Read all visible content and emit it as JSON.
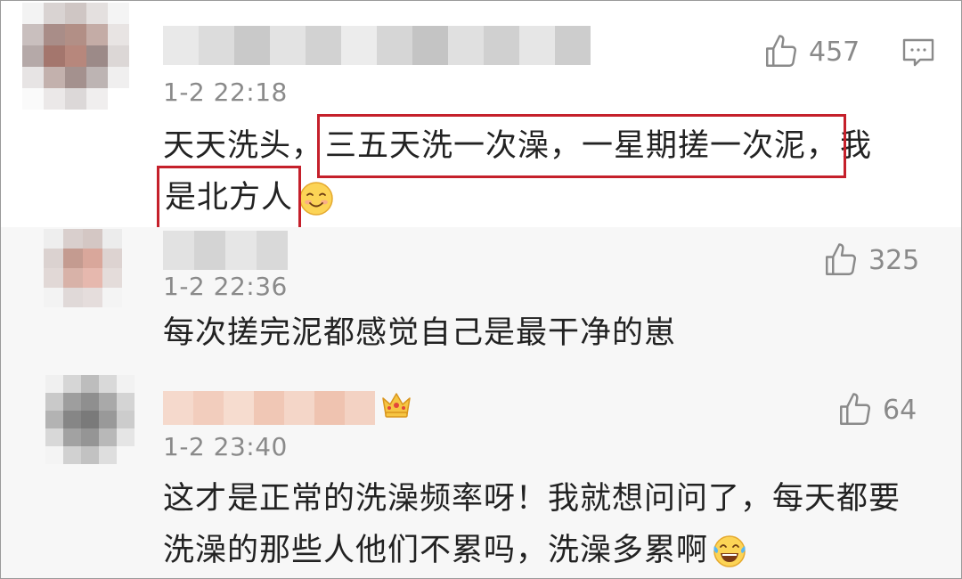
{
  "comments": [
    {
      "time": "1-2 22:18",
      "likes": "457",
      "text_parts": {
        "before": "天天洗头，",
        "highlight1": "三五天洗一次澡，一星期搓一次泥，",
        "after": "我",
        "highlight2": "是北方人"
      },
      "emoji": "smile-emoji",
      "has_reply_icon": true
    },
    {
      "time": "1-2 22:36",
      "likes": "325",
      "text": "每次搓完泥都感觉自己是最干净的崽"
    },
    {
      "time": "1-2 23:40",
      "likes": "64",
      "text_line1": "这才是正常的洗澡频率呀！我就想问问了，每天都要",
      "text_line2": "洗澡的那些人他们不累吗，洗澡多累啊",
      "emoji": "laugh-cry-emoji",
      "badge": "crown-icon"
    }
  ],
  "colors": {
    "highlight_box": "#c5202b",
    "meta_gray": "#8a8a8a",
    "text": "#222222",
    "alt_background": "#f7f7f7"
  }
}
